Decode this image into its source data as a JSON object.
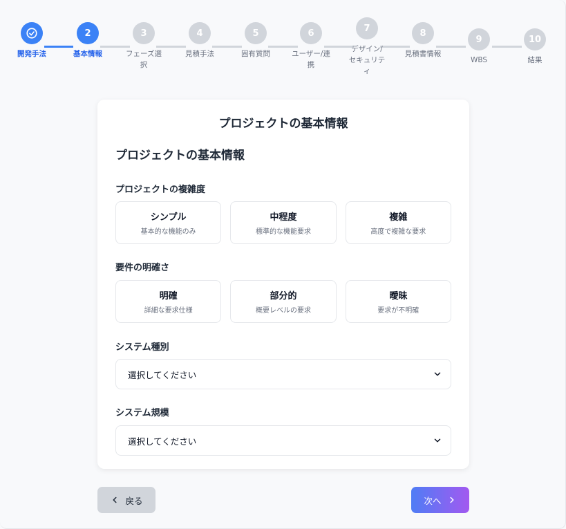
{
  "steps": [
    {
      "number": "",
      "label": "開発手法",
      "state": "done"
    },
    {
      "number": "2",
      "label": "基本情報",
      "state": "active"
    },
    {
      "number": "3",
      "label": "フェーズ選択",
      "state": "pending"
    },
    {
      "number": "4",
      "label": "見積手法",
      "state": "pending"
    },
    {
      "number": "5",
      "label": "固有質問",
      "state": "pending"
    },
    {
      "number": "6",
      "label": "ユーザー/連携",
      "state": "pending"
    },
    {
      "number": "7",
      "label": "デザイン/セキュリティ",
      "state": "pending"
    },
    {
      "number": "8",
      "label": "見積書情報",
      "state": "pending"
    },
    {
      "number": "9",
      "label": "WBS",
      "state": "pending"
    },
    {
      "number": "10",
      "label": "結果",
      "state": "pending"
    }
  ],
  "card": {
    "title": "プロジェクトの基本情報",
    "section_title": "プロジェクトの基本情報",
    "complexity": {
      "label": "プロジェクトの複雑度",
      "options": [
        {
          "title": "シンプル",
          "desc": "基本的な機能のみ"
        },
        {
          "title": "中程度",
          "desc": "標準的な機能要求"
        },
        {
          "title": "複雑",
          "desc": "高度で複雑な要求"
        }
      ]
    },
    "clarity": {
      "label": "要件の明確さ",
      "options": [
        {
          "title": "明確",
          "desc": "詳細な要求仕様"
        },
        {
          "title": "部分的",
          "desc": "概要レベルの要求"
        },
        {
          "title": "曖昧",
          "desc": "要求が不明確"
        }
      ]
    },
    "system_type": {
      "label": "システム種別",
      "value": "選択してください"
    },
    "system_scale": {
      "label": "システム規模",
      "value": "選択してください"
    }
  },
  "nav": {
    "back_label": "戻る",
    "next_label": "次へ"
  },
  "colors": {
    "accent": "#3b82f6",
    "pending": "#d1d5db",
    "next_gradient_start": "#4f7df5",
    "next_gradient_end": "#a259f0"
  }
}
